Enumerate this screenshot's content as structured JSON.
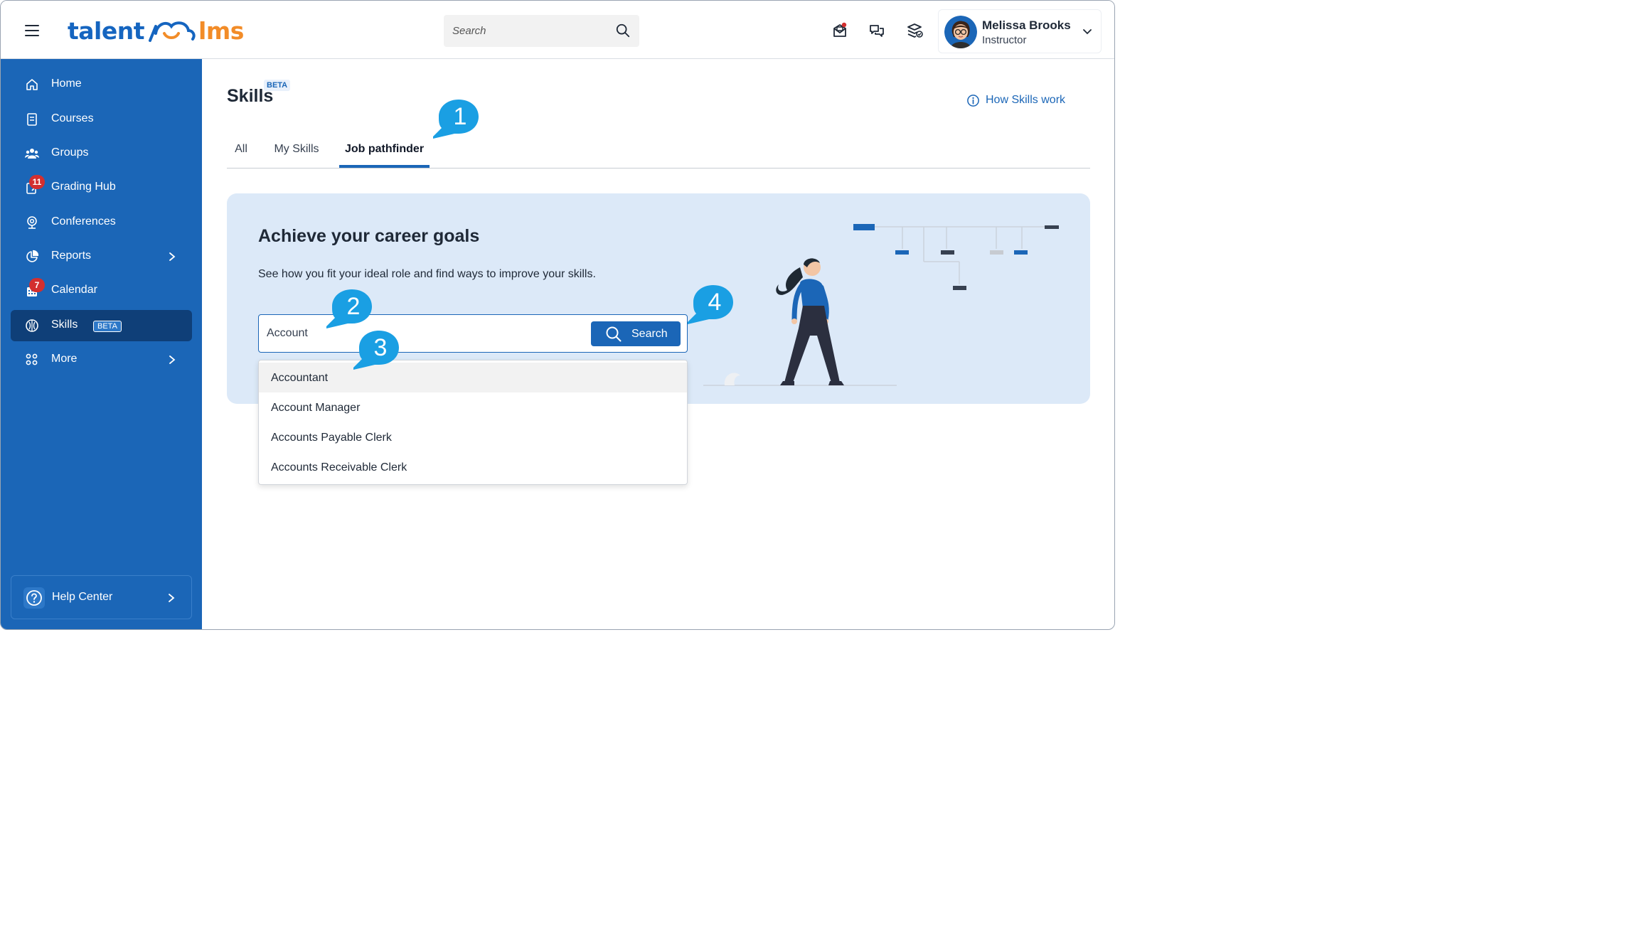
{
  "header": {
    "logo_left": "talent",
    "logo_right": "lms",
    "search_placeholder": "Search",
    "user_name": "Melissa Brooks",
    "user_role": "Instructor"
  },
  "sidebar": {
    "items": [
      {
        "label": "Home",
        "icon": "home-icon"
      },
      {
        "label": "Courses",
        "icon": "courses-icon"
      },
      {
        "label": "Groups",
        "icon": "groups-icon"
      },
      {
        "label": "Grading Hub",
        "icon": "grading-icon",
        "badge": "11"
      },
      {
        "label": "Conferences",
        "icon": "conferences-icon"
      },
      {
        "label": "Reports",
        "icon": "reports-icon"
      },
      {
        "label": "Calendar",
        "icon": "calendar-icon",
        "badge": "7"
      },
      {
        "label": "Skills",
        "icon": "skills-icon",
        "tag": "BETA"
      },
      {
        "label": "More",
        "icon": "more-icon"
      }
    ],
    "help": "Help Center"
  },
  "page": {
    "title": "Skills",
    "title_tag": "BETA",
    "how_link": "How Skills work",
    "tabs": [
      "All",
      "My Skills",
      "Job pathfinder"
    ],
    "active_tab": "Job pathfinder"
  },
  "panel": {
    "title": "Achieve your career goals",
    "subtitle": "See how you fit your ideal role and find ways to improve your skills.",
    "input_value": "Account",
    "search_button": "Search",
    "suggestions": [
      "Accountant",
      "Account Manager",
      "Accounts Payable Clerk",
      "Accounts Receivable Clerk"
    ]
  },
  "callouts": [
    "1",
    "2",
    "3",
    "4"
  ],
  "colors": {
    "primary": "#1b66b7",
    "sidebar_active": "#0f3f78",
    "accent_orange": "#f28c28",
    "panel_bg": "#dce9f8",
    "callout": "#1a9fe3",
    "badge": "#d32f2f"
  }
}
